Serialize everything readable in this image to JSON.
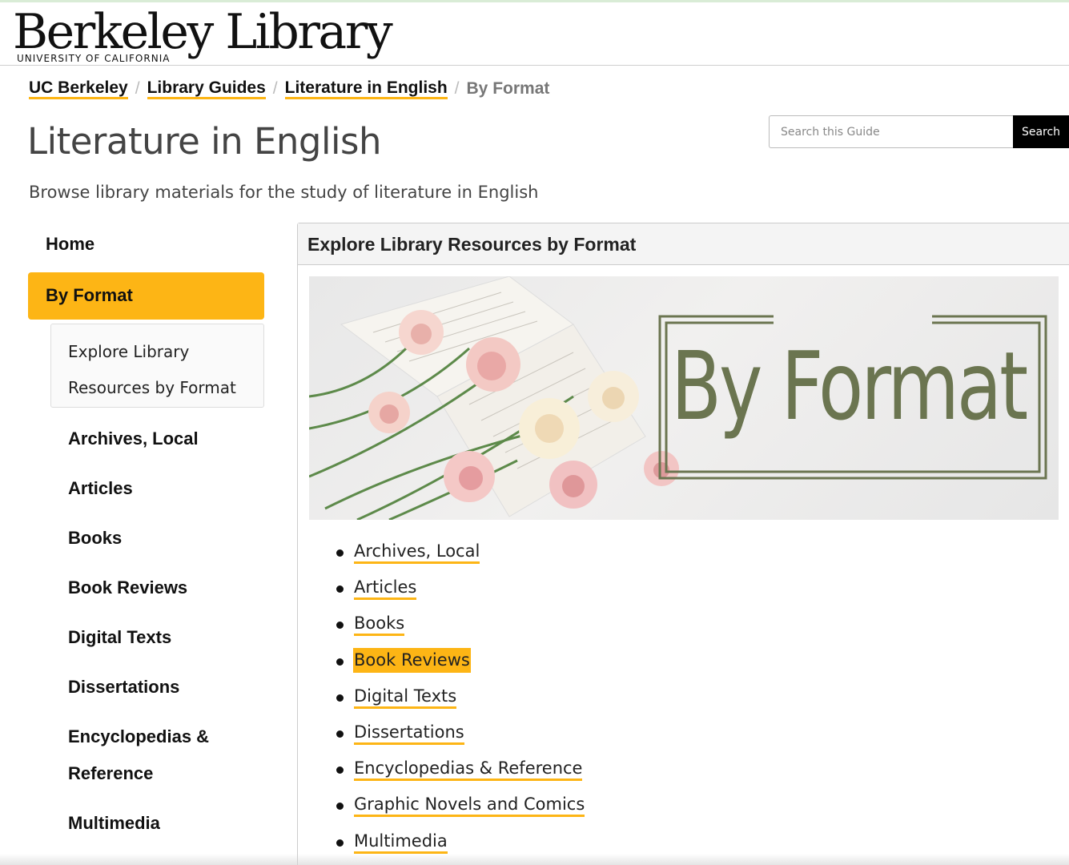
{
  "header": {
    "logo_text": "Berkeley Library",
    "logo_subtitle": "UNIVERSITY OF CALIFORNIA"
  },
  "breadcrumb": {
    "items": [
      "UC Berkeley",
      "Library Guides",
      "Literature in English"
    ],
    "separator": "/",
    "current": "By Format"
  },
  "page": {
    "title": "Literature in English",
    "subtitle": "Browse library materials for the study of literature in English"
  },
  "search": {
    "placeholder": "Search this Guide",
    "button_label": "Search"
  },
  "sidenav": {
    "home": "Home",
    "active": "By Format",
    "subitem": "Explore Library Resources by Format",
    "items": [
      "Archives, Local",
      "Articles",
      "Books",
      "Book Reviews",
      "Digital Texts",
      "Dissertations",
      "Encyclopedias & Reference",
      "Multimedia"
    ]
  },
  "panel": {
    "heading": "Explore Library Resources by Format",
    "banner_text": "By Format",
    "links": [
      "Archives, Local",
      "Articles",
      "Books",
      "Book Reviews",
      "Digital Texts",
      "Dissertations",
      "Encyclopedias & Reference",
      "Graphic Novels and Comics",
      "Multimedia"
    ],
    "highlighted_link": "Book Reviews"
  },
  "colors": {
    "accent": "#fdb515",
    "banner_text": "#6b7550",
    "search_button": "#000000"
  }
}
